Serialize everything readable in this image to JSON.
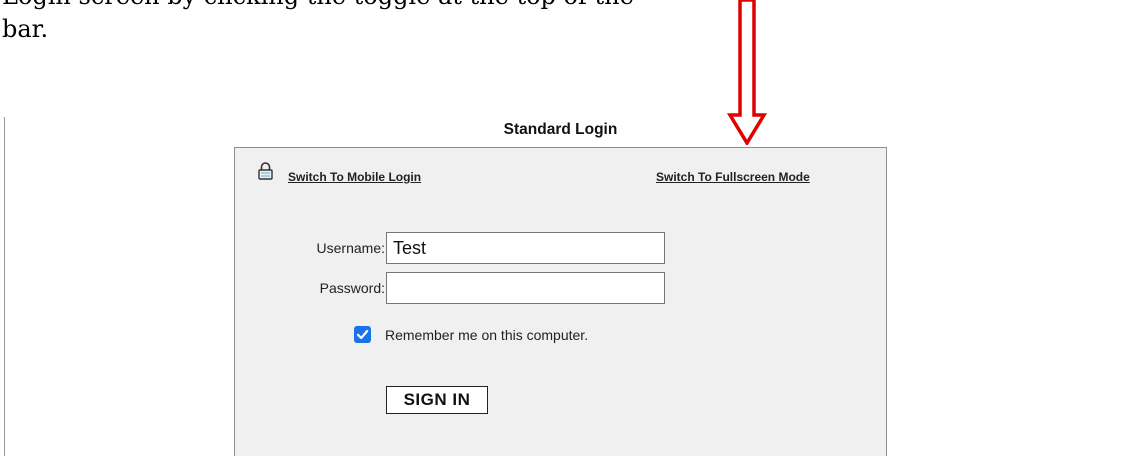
{
  "document": {
    "line1": "Login screen by clicking the toggle at the top of the",
    "line2": "bar."
  },
  "login": {
    "title": "Standard Login",
    "switch_mobile_label": "Switch To Mobile Login",
    "switch_fullscreen_label": "Switch To Fullscreen Mode",
    "username_label": "Username:",
    "username_value": "Test",
    "password_label": "Password:",
    "password_value": "",
    "remember_label": "Remember me on this computer.",
    "remember_checked": true,
    "signin_label": "SIGN IN"
  },
  "colors": {
    "arrow": "#e00000",
    "panel_background": "#f0f0f0",
    "checkbox": "#1a73e8"
  },
  "icons": {
    "lock": "lock-icon",
    "arrow": "down-arrow-icon",
    "check": "checkmark-icon"
  }
}
